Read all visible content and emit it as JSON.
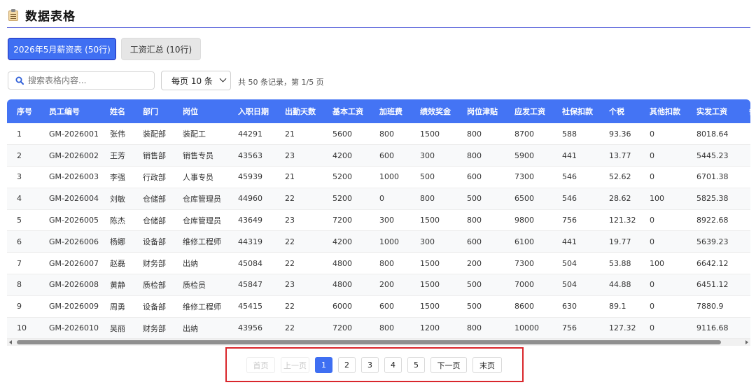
{
  "header": {
    "title": "数据表格"
  },
  "tabs": [
    {
      "label": "2026年5月薪资表 (50行)",
      "active": true
    },
    {
      "label": "工资汇总 (10行)",
      "active": false
    }
  ],
  "toolbar": {
    "search_placeholder": "搜索表格内容...",
    "page_size_label": "每页 10 条",
    "record_info": "共 50 条记录，第 1/5 页"
  },
  "table": {
    "columns": [
      "序号",
      "员工编号",
      "姓名",
      "部门",
      "岗位",
      "入职日期",
      "出勤天数",
      "基本工资",
      "加班费",
      "绩效奖金",
      "岗位津贴",
      "应发工资",
      "社保扣款",
      "个税",
      "其他扣款",
      "实发工资",
      "备"
    ],
    "rows": [
      [
        "1",
        "GM-2026001",
        "张伟",
        "装配部",
        "装配工",
        "44291",
        "21",
        "5600",
        "800",
        "1500",
        "800",
        "8700",
        "588",
        "93.36",
        "0",
        "8018.64",
        ""
      ],
      [
        "2",
        "GM-2026002",
        "王芳",
        "销售部",
        "销售专员",
        "43563",
        "23",
        "4200",
        "600",
        "300",
        "800",
        "5900",
        "441",
        "13.77",
        "0",
        "5445.23",
        ""
      ],
      [
        "3",
        "GM-2026003",
        "李强",
        "行政部",
        "人事专员",
        "45939",
        "21",
        "5200",
        "1000",
        "500",
        "600",
        "7300",
        "546",
        "52.62",
        "0",
        "6701.38",
        ""
      ],
      [
        "4",
        "GM-2026004",
        "刘敏",
        "仓储部",
        "仓库管理员",
        "44960",
        "22",
        "5200",
        "0",
        "800",
        "500",
        "6500",
        "546",
        "28.62",
        "100",
        "5825.38",
        ""
      ],
      [
        "5",
        "GM-2026005",
        "陈杰",
        "仓储部",
        "仓库管理员",
        "43649",
        "23",
        "7200",
        "300",
        "1500",
        "800",
        "9800",
        "756",
        "121.32",
        "0",
        "8922.68",
        ""
      ],
      [
        "6",
        "GM-2026006",
        "杨娜",
        "设备部",
        "维修工程师",
        "44319",
        "22",
        "4200",
        "1000",
        "300",
        "600",
        "6100",
        "441",
        "19.77",
        "0",
        "5639.23",
        ""
      ],
      [
        "7",
        "GM-2026007",
        "赵磊",
        "财务部",
        "出纳",
        "45084",
        "22",
        "4800",
        "800",
        "1500",
        "200",
        "7300",
        "504",
        "53.88",
        "100",
        "6642.12",
        ""
      ],
      [
        "8",
        "GM-2026008",
        "黄静",
        "质检部",
        "质检员",
        "45847",
        "23",
        "4800",
        "200",
        "1500",
        "500",
        "7000",
        "504",
        "44.88",
        "0",
        "6451.12",
        ""
      ],
      [
        "9",
        "GM-2026009",
        "周勇",
        "设备部",
        "维修工程师",
        "45415",
        "22",
        "6000",
        "600",
        "1500",
        "500",
        "8600",
        "630",
        "89.1",
        "0",
        "7880.9",
        ""
      ],
      [
        "10",
        "GM-2026010",
        "吴丽",
        "财务部",
        "出纳",
        "43956",
        "22",
        "7200",
        "800",
        "1200",
        "800",
        "10000",
        "756",
        "127.32",
        "0",
        "9116.68",
        ""
      ]
    ]
  },
  "pagination": {
    "first": "首页",
    "prev": "上一页",
    "pages": [
      "1",
      "2",
      "3",
      "4",
      "5"
    ],
    "current": "1",
    "next": "下一页",
    "last": "末页"
  },
  "colors": {
    "accent": "#3f6ff2",
    "header_bg": "#4474f4",
    "highlight": "#d9262c"
  }
}
